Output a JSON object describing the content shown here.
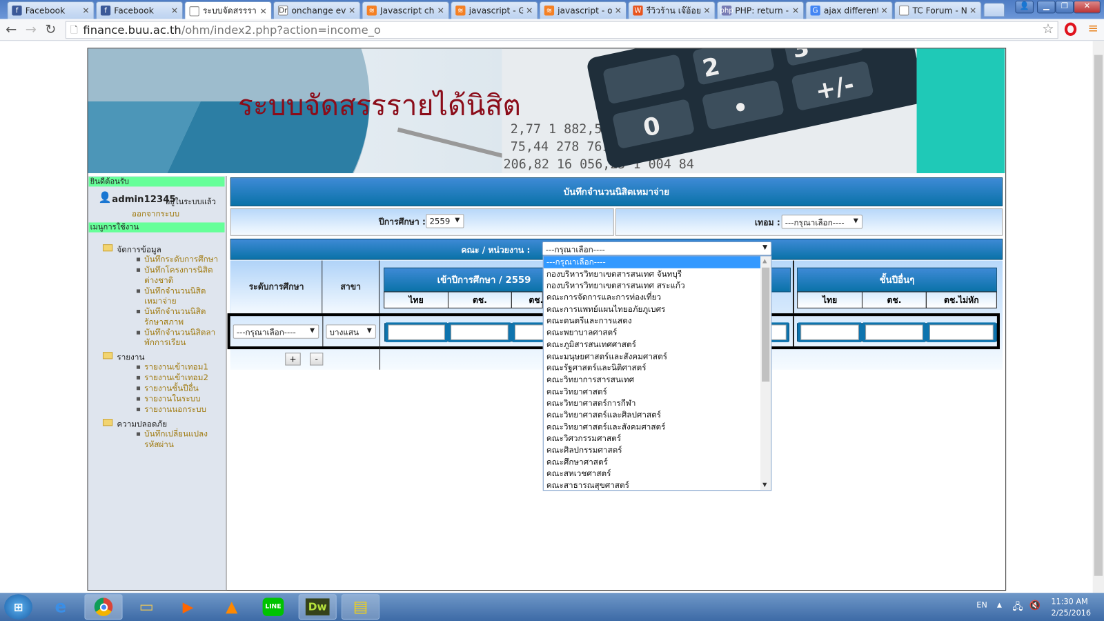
{
  "browser": {
    "tabs": [
      {
        "title": "Facebook",
        "icon": "facebook-icon",
        "color": "#3b5998",
        "glyph": "f"
      },
      {
        "title": "Facebook",
        "icon": "facebook-icon",
        "color": "#3b5998",
        "glyph": "f"
      },
      {
        "title": "ระบบจัดสรรราย",
        "icon": "page-icon",
        "color": "#fff",
        "glyph": "",
        "active": true
      },
      {
        "title": "onchange eve",
        "icon": "dreamincode-icon",
        "color": "#fff",
        "glyph": "Dr"
      },
      {
        "title": "Javascript che",
        "icon": "stackoverflow-icon",
        "color": "#f48024",
        "glyph": "≋"
      },
      {
        "title": "javascript - Ge",
        "icon": "stackoverflow-icon",
        "color": "#f48024",
        "glyph": "≋"
      },
      {
        "title": "javascript - on",
        "icon": "stackoverflow-icon",
        "color": "#f48024",
        "glyph": "≋"
      },
      {
        "title": "รีวิวร้าน เจ๊อ้อยต์",
        "icon": "wongnai-icon",
        "color": "#e8541d",
        "glyph": "W"
      },
      {
        "title": "PHP: return - I",
        "icon": "php-icon",
        "color": "#777bb3",
        "glyph": "php"
      },
      {
        "title": "ajax different",
        "icon": "google-icon",
        "color": "#4285f4",
        "glyph": "G"
      },
      {
        "title": "TC Forum - Ne",
        "icon": "page-icon",
        "color": "#fff",
        "glyph": ""
      }
    ],
    "url_host": "finance.buu.ac.th",
    "url_path": "/ohm/index2.php?action=income_o"
  },
  "banner": {
    "title": "ระบบจัดสรรรายได้นิสิต"
  },
  "sidebar": {
    "welcome": "ยินดีต้อนรับ",
    "username": "admin12345",
    "logged_in": "อยู่ในระบบแล้ว",
    "logout": "ออกจากระบบ",
    "menu_header": "เมนูการใช้งาน",
    "groups": [
      {
        "label": "จัดการข้อมูล",
        "items": [
          "บันทึกระดับการศึกษา",
          "บันทึกโครงการนิสิต ต่างชาติ",
          "บันทึกจำนวนนิสิต เหมาจ่าย",
          "บันทึกจำนวนนิสิต รักษาสภาพ",
          "บันทึกจำนวนนิสิตลา พักการเรียน"
        ]
      },
      {
        "label": "รายงาน",
        "items": [
          "รายงานเข้าเทอม1",
          "รายงานเข้าเทอม2",
          "รายงานชั้นปีอื่น",
          "รายงานในระบบ",
          "รายงานนอกระบบ"
        ]
      },
      {
        "label": "ความปลอดภัย",
        "items": [
          "บันทึกเปลี่ยนแปลง รหัสผ่าน"
        ]
      }
    ]
  },
  "main": {
    "header": "บันทึกจำนวนนิสิตเหมาจ่าย",
    "year_label": "ปีการศึกษา :",
    "year_value": "2559",
    "term_label": "เทอม :",
    "term_value": "---กรุณาเลือก----",
    "faculty_label": "คณะ / หน่วยงาน :",
    "faculty_value": "---กรุณาเลือก----",
    "col_level": "ระดับการศึกษา",
    "col_branch": "สาขา",
    "group_entry": "เข้าปีการศึกษา / 2559",
    "group_other": "ชั้นปีอื่นๆ",
    "sub_thai": "ไทย",
    "sub_foreign": "ตช.",
    "sub_foreign_nodeduct": "ตช.ไม่หัก",
    "level_value": "---กรุณาเลือก----",
    "branch_value": "บางแสน",
    "add_label": "+",
    "remove_label": "-"
  },
  "faculty_options": [
    "---กรุณาเลือก----",
    "กองบริหารวิทยาเขตสารสนเทศ จันทบุรี",
    "กองบริหารวิทยาเขตสารสนเทศ สระแก้ว",
    "คณะการจัดการและการท่องเที่ยว",
    "คณะการแพทย์แผนไทยอภัยภูเบศร",
    "คณะดนตรีและการแสดง",
    "คณะพยาบาลศาสตร์",
    "คณะภูมิสารสนเทศศาสตร์",
    "คณะมนุษยศาสตร์และสังคมศาสตร์",
    "คณะรัฐศาสตร์และนิติศาสตร์",
    "คณะวิทยาการสารสนเทศ",
    "คณะวิทยาศาสตร์",
    "คณะวิทยาศาสตร์การกีฬา",
    "คณะวิทยาศาสตร์และศิลปศาสตร์",
    "คณะวิทยาศาสตร์และสังคมศาสตร์",
    "คณะวิศวกรรมศาสตร์",
    "คณะศิลปกรรมศาสตร์",
    "คณะศึกษาศาสตร์",
    "คณะสหเวชศาสตร์",
    "คณะสาธารณสุขศาสตร์"
  ],
  "taskbar": {
    "lang": "EN",
    "time": "11:30 AM",
    "date": "2/25/2016"
  }
}
